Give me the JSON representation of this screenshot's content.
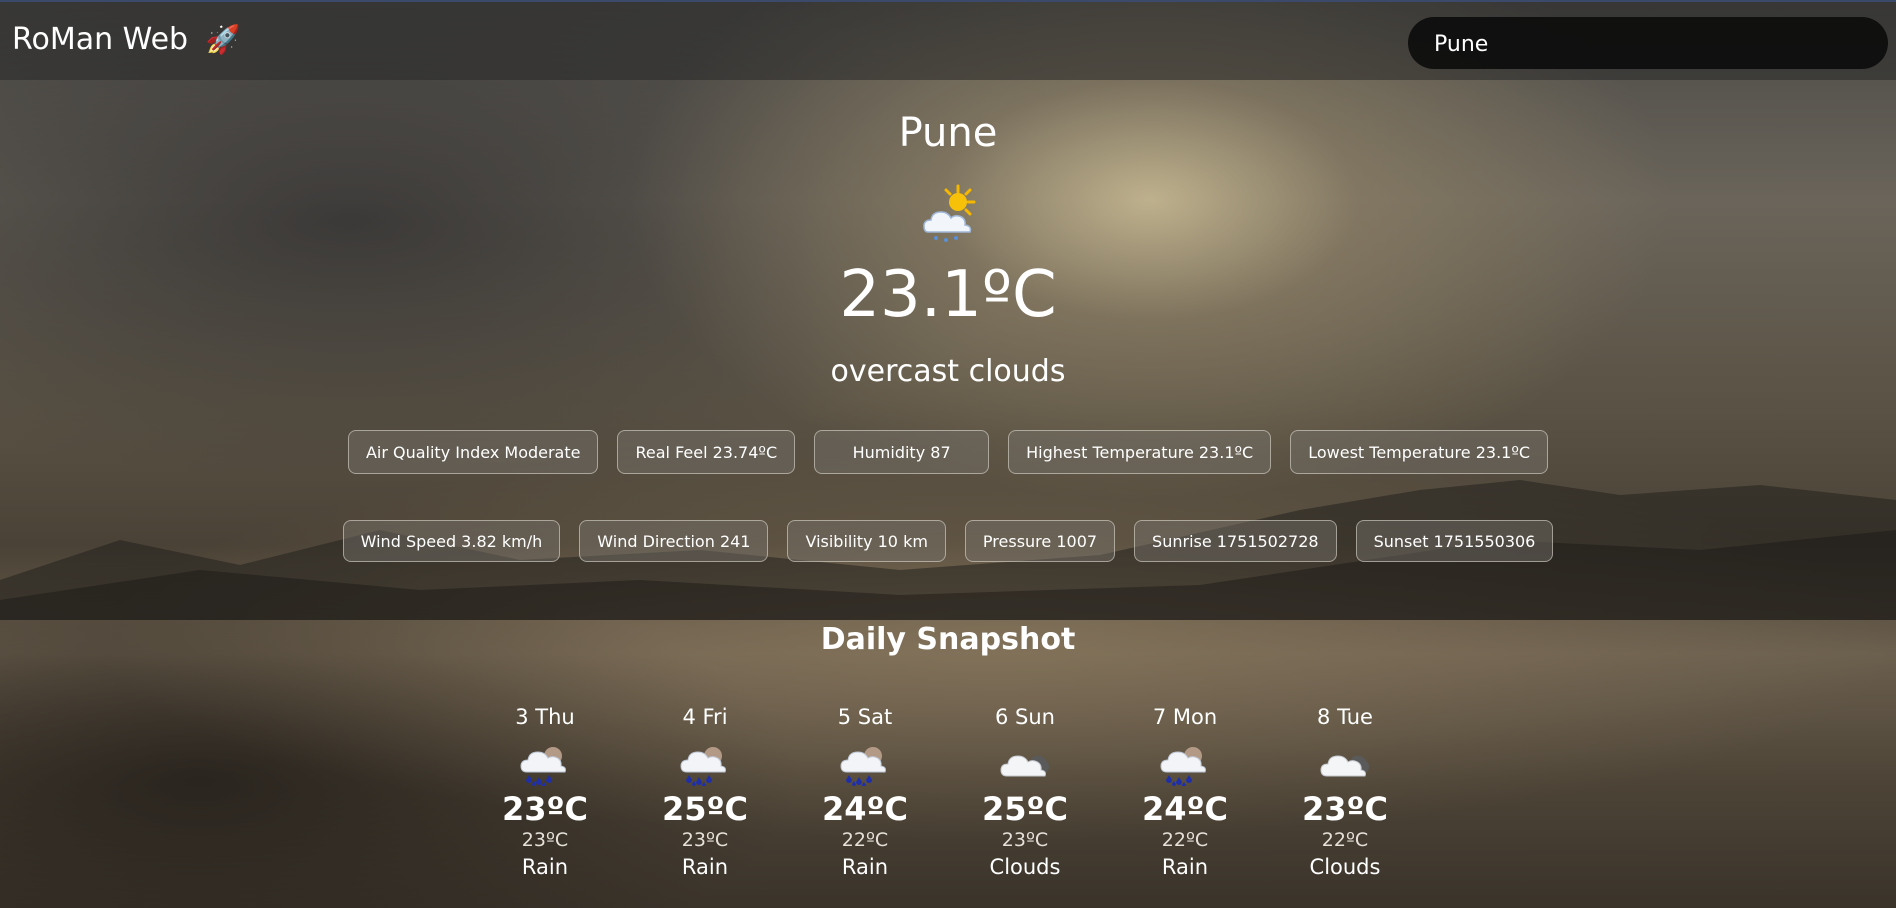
{
  "header": {
    "brand": "RoMan Web",
    "brand_icon": "rocket-icon"
  },
  "search": {
    "value": "Pune",
    "placeholder": ""
  },
  "current": {
    "city": "Pune",
    "icon": "partly-cloudy-sun-icon",
    "temperature": "23.1ºC",
    "condition": "overcast clouds"
  },
  "details_row1": [
    "Air Quality Index Moderate",
    "Real Feel 23.74ºC",
    "Humidity 87",
    "Highest Temperature 23.1ºC",
    "Lowest Temperature 23.1ºC"
  ],
  "details_row2": [
    "Wind Speed 3.82 km/h",
    "Wind Direction 241",
    "Visibility 10 km",
    "Pressure 1007",
    "Sunrise 1751502728",
    "Sunset 1751550306"
  ],
  "daily": {
    "title": "Daily Snapshot",
    "days": [
      {
        "label": "3 Thu",
        "icon": "rain-cloud-icon",
        "high": "23ºC",
        "low": "23ºC",
        "desc": "Rain"
      },
      {
        "label": "4 Fri",
        "icon": "rain-cloud-icon",
        "high": "25ºC",
        "low": "23ºC",
        "desc": "Rain"
      },
      {
        "label": "5 Sat",
        "icon": "rain-cloud-icon",
        "high": "24ºC",
        "low": "22ºC",
        "desc": "Rain"
      },
      {
        "label": "6 Sun",
        "icon": "cloud-icon",
        "high": "25ºC",
        "low": "23ºC",
        "desc": "Clouds"
      },
      {
        "label": "7 Mon",
        "icon": "rain-cloud-icon",
        "high": "24ºC",
        "low": "22ºC",
        "desc": "Rain"
      },
      {
        "label": "8 Tue",
        "icon": "cloud-icon",
        "high": "23ºC",
        "low": "22ºC",
        "desc": "Clouds"
      }
    ]
  }
}
